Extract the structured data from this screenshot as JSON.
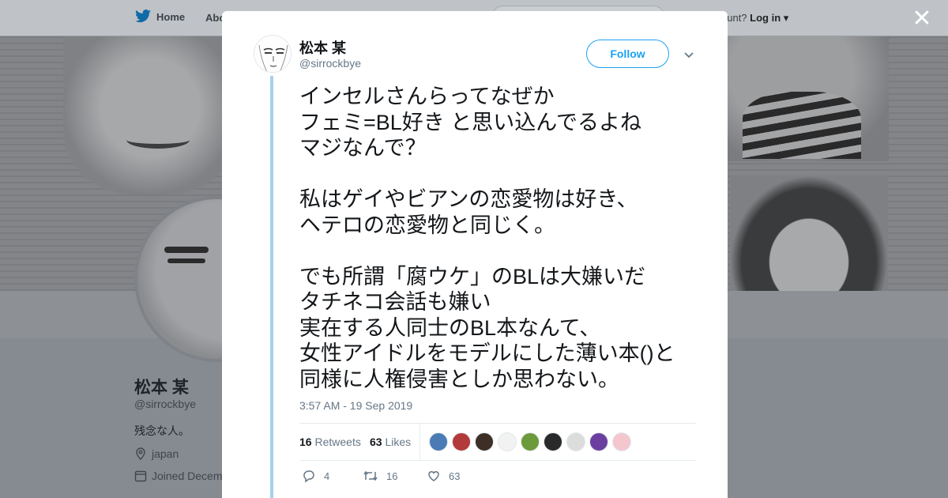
{
  "nav": {
    "home_label": "Home",
    "about_label": "Abo",
    "account_prompt": "ccount?",
    "login_label": "Log in"
  },
  "background_profile": {
    "name": "松本 某",
    "handle": "@sirrockbye",
    "bio": "残念な人。",
    "location": "japan",
    "joined": "Joined Decem"
  },
  "tweet": {
    "author_name": "松本 某",
    "author_handle": "@sirrockbye",
    "follow_label": "Follow",
    "text": "インセルさんらってなぜか\nフェミ=BL好き と思い込んでるよね\nマジなんで？\n\n私はゲイやビアンの恋愛物は好き、\nヘテロの恋愛物と同じく。\n\nでも所謂「腐ウケ」のBLは大嫌いだ\nタチネコ会話も嫌い\n実在する人同士のBL本なんて、\n女性アイドルをモデルにした薄い本()と\n同様に人権侵害としか思わない。",
    "timestamp": "3:57 AM - 19 Sep 2019",
    "retweets_count": "16",
    "retweets_label": "Retweets",
    "likes_count": "63",
    "likes_label": "Likes",
    "reply_count": "4",
    "retweet_action_count": "16",
    "like_action_count": "63"
  },
  "likers": [
    {
      "name": "liker-avatar",
      "color": "#4a7bb5"
    },
    {
      "name": "liker-avatar",
      "color": "#b33a3a"
    },
    {
      "name": "liker-avatar",
      "color": "#3d2f25"
    },
    {
      "name": "liker-avatar",
      "color": "#f2f2f2"
    },
    {
      "name": "liker-avatar",
      "color": "#6d9a3a"
    },
    {
      "name": "liker-avatar",
      "color": "#2a2a2a"
    },
    {
      "name": "liker-avatar",
      "color": "#dcdcdc"
    },
    {
      "name": "liker-avatar",
      "color": "#6b3fa0"
    },
    {
      "name": "liker-avatar",
      "color": "#f4c7cf"
    }
  ],
  "colors": {
    "accent": "#1da1f2",
    "thread_line": "#a8d0ec"
  }
}
